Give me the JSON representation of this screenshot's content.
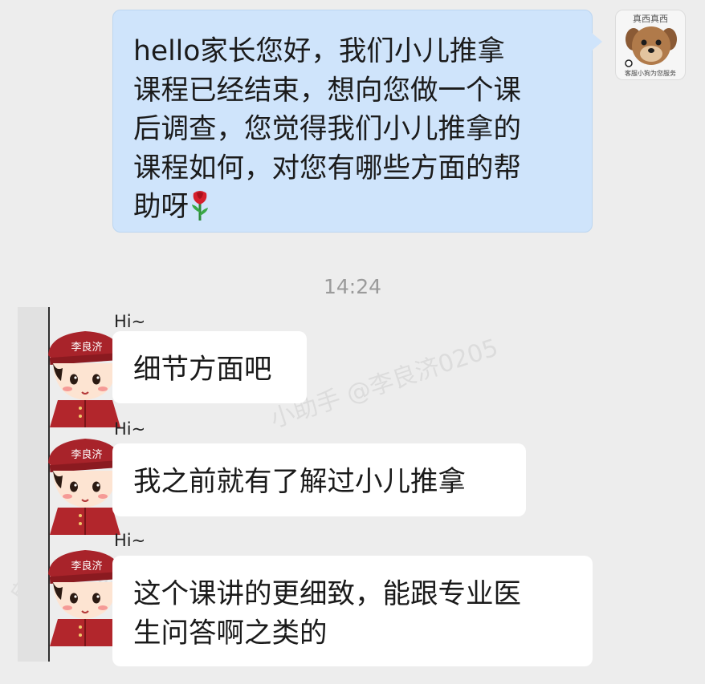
{
  "chat": {
    "outgoing": {
      "lines": [
        "hello家长您好，我们小儿推拿",
        "课程已经结束，想向您做一个课",
        "后调查，您觉得我们小儿推拿的",
        "课程如何，对您有哪些方面的帮",
        "助呀"
      ],
      "emoji": "rose-icon"
    },
    "self_avatar": {
      "top_text": "真西真西",
      "bottom_text": "客服小狗为您服务"
    },
    "timestamp": "14:24",
    "sticker": {
      "greeting": "Hi~",
      "hat_text": "李良济"
    },
    "incoming": [
      {
        "lines": [
          "细节方面吧"
        ]
      },
      {
        "lines": [
          "我之前就有了解过小儿推拿"
        ]
      },
      {
        "lines": [
          "这个课讲的更细致，能跟专业医",
          "生问答啊之类的"
        ]
      }
    ],
    "watermark": "小助手 @李良济0205",
    "watermark_fragment": "良",
    "watermark_fragment2": "05"
  }
}
